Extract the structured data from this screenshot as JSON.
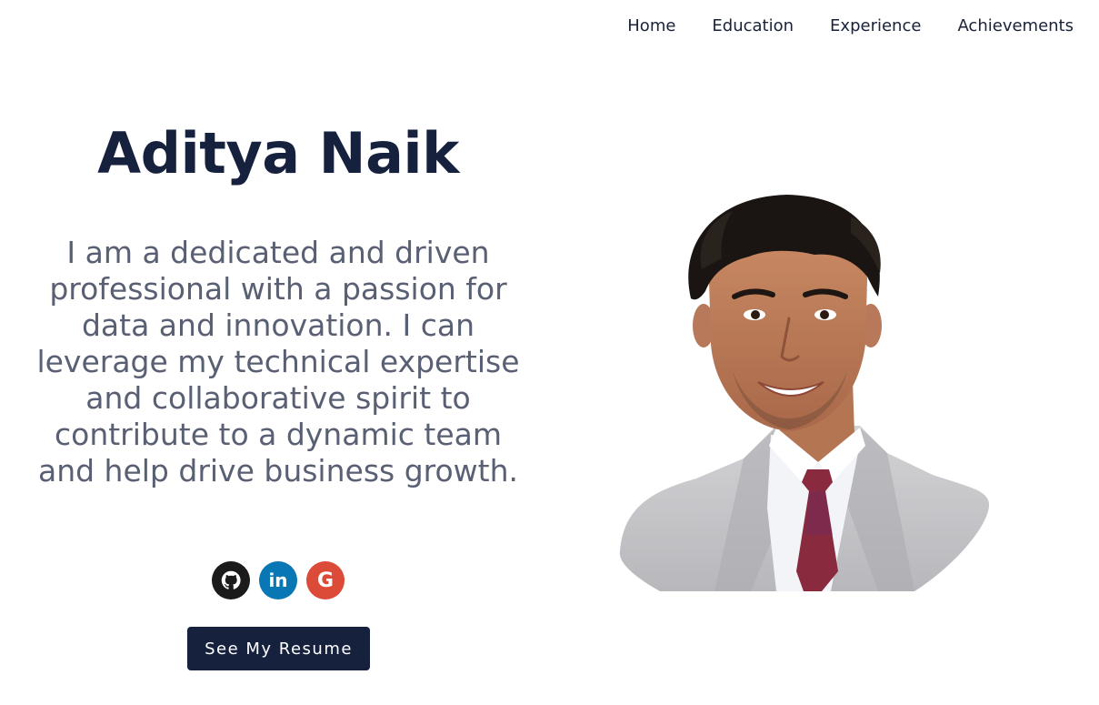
{
  "nav": {
    "items": [
      {
        "label": "Home"
      },
      {
        "label": "Education"
      },
      {
        "label": "Experience"
      },
      {
        "label": "Achievements"
      }
    ]
  },
  "hero": {
    "name": "Aditya Naik",
    "bio": "I am a dedicated and driven professional with a passion for data and innovation. I can leverage my technical expertise and collaborative spirit to contribute to a dynamic team and help drive business growth.",
    "resume_button_label": "See My Resume"
  },
  "socials": [
    {
      "icon": "github-icon",
      "color": "#1b1b1b"
    },
    {
      "icon": "linkedin-icon",
      "color": "#0a77b5",
      "text": "in"
    },
    {
      "icon": "google-icon",
      "color": "#dc4a38",
      "text": "G"
    }
  ],
  "colors": {
    "primary": "#16213e",
    "text_muted": "#5a6073"
  }
}
